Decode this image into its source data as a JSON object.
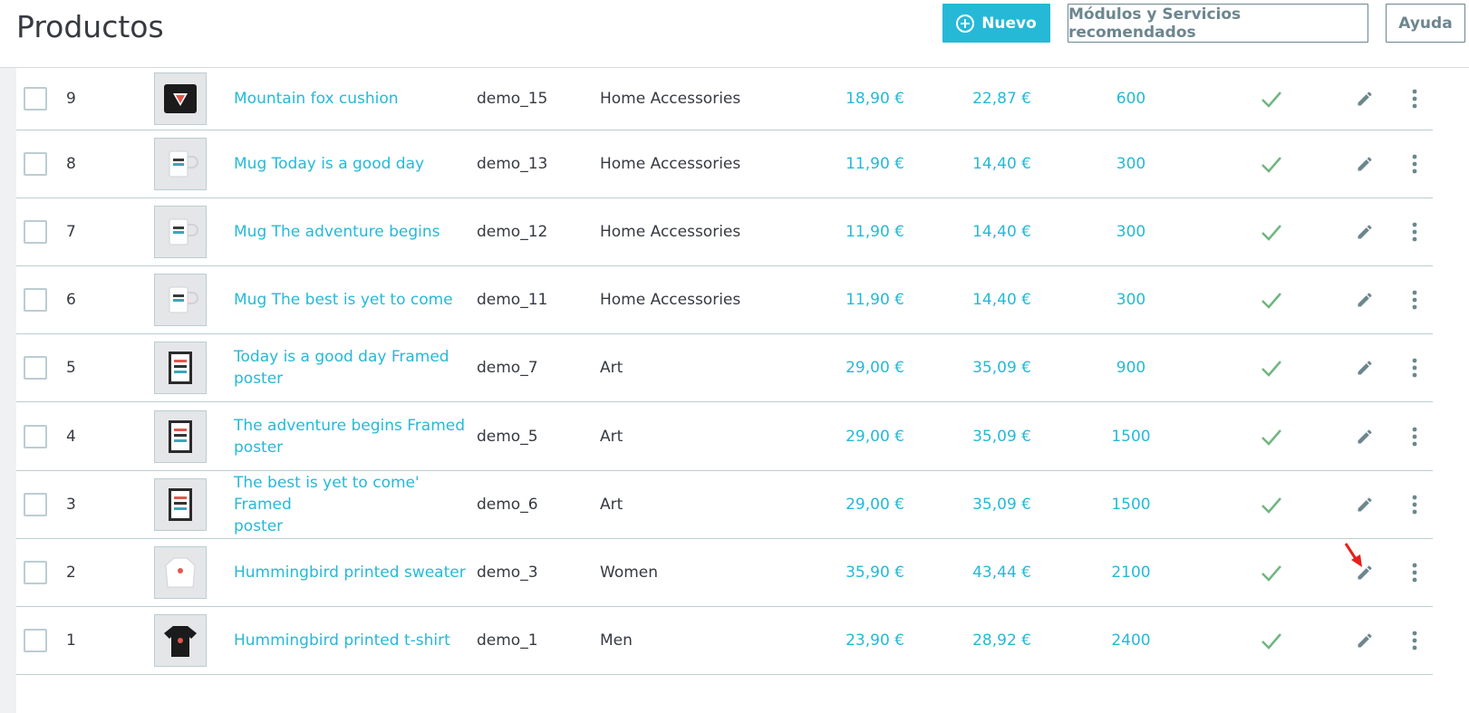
{
  "header": {
    "title": "Productos",
    "new_label": "Nuevo",
    "modules_label": "Módulos y Servicios recomendados",
    "help_label": "Ayuda"
  },
  "colors": {
    "accent": "#25b9d7",
    "success": "#70b580",
    "text": "#363a41",
    "border": "#bbcdd2"
  },
  "icons": {
    "status": "check-icon",
    "edit": "pencil-icon",
    "more": "kebab-menu-icon",
    "new": "plus-circle-icon"
  },
  "products": [
    {
      "id": "9",
      "name": [
        "Mountain fox cushion"
      ],
      "reference": "demo_15",
      "category": "Home Accessories",
      "price": "18,90 €",
      "price_tax": "22,87 €",
      "quantity": "600",
      "thumb": "cushion"
    },
    {
      "id": "8",
      "name": [
        "Mug Today is a good day"
      ],
      "reference": "demo_13",
      "category": "Home Accessories",
      "price": "11,90 €",
      "price_tax": "14,40 €",
      "quantity": "300",
      "thumb": "mug"
    },
    {
      "id": "7",
      "name": [
        "Mug The adventure begins"
      ],
      "reference": "demo_12",
      "category": "Home Accessories",
      "price": "11,90 €",
      "price_tax": "14,40 €",
      "quantity": "300",
      "thumb": "mug"
    },
    {
      "id": "6",
      "name": [
        "Mug The best is yet to come"
      ],
      "reference": "demo_11",
      "category": "Home Accessories",
      "price": "11,90 €",
      "price_tax": "14,40 €",
      "quantity": "300",
      "thumb": "mug"
    },
    {
      "id": "5",
      "name": [
        "Today is a good day Framed",
        "poster"
      ],
      "reference": "demo_7",
      "category": "Art",
      "price": "29,00 €",
      "price_tax": "35,09 €",
      "quantity": "900",
      "thumb": "poster"
    },
    {
      "id": "4",
      "name": [
        "The adventure begins Framed",
        "poster"
      ],
      "reference": "demo_5",
      "category": "Art",
      "price": "29,00 €",
      "price_tax": "35,09 €",
      "quantity": "1500",
      "thumb": "poster"
    },
    {
      "id": "3",
      "name": [
        "The best is yet to come' Framed",
        "poster"
      ],
      "reference": "demo_6",
      "category": "Art",
      "price": "29,00 €",
      "price_tax": "35,09 €",
      "quantity": "1500",
      "thumb": "poster"
    },
    {
      "id": "2",
      "name": [
        "Hummingbird printed sweater"
      ],
      "reference": "demo_3",
      "category": "Women",
      "price": "35,90 €",
      "price_tax": "43,44 €",
      "quantity": "2100",
      "thumb": "sweater"
    },
    {
      "id": "1",
      "name": [
        "Hummingbird printed t-shirt"
      ],
      "reference": "demo_1",
      "category": "Men",
      "price": "23,90 €",
      "price_tax": "28,92 €",
      "quantity": "2400",
      "thumb": "tshirt"
    }
  ]
}
